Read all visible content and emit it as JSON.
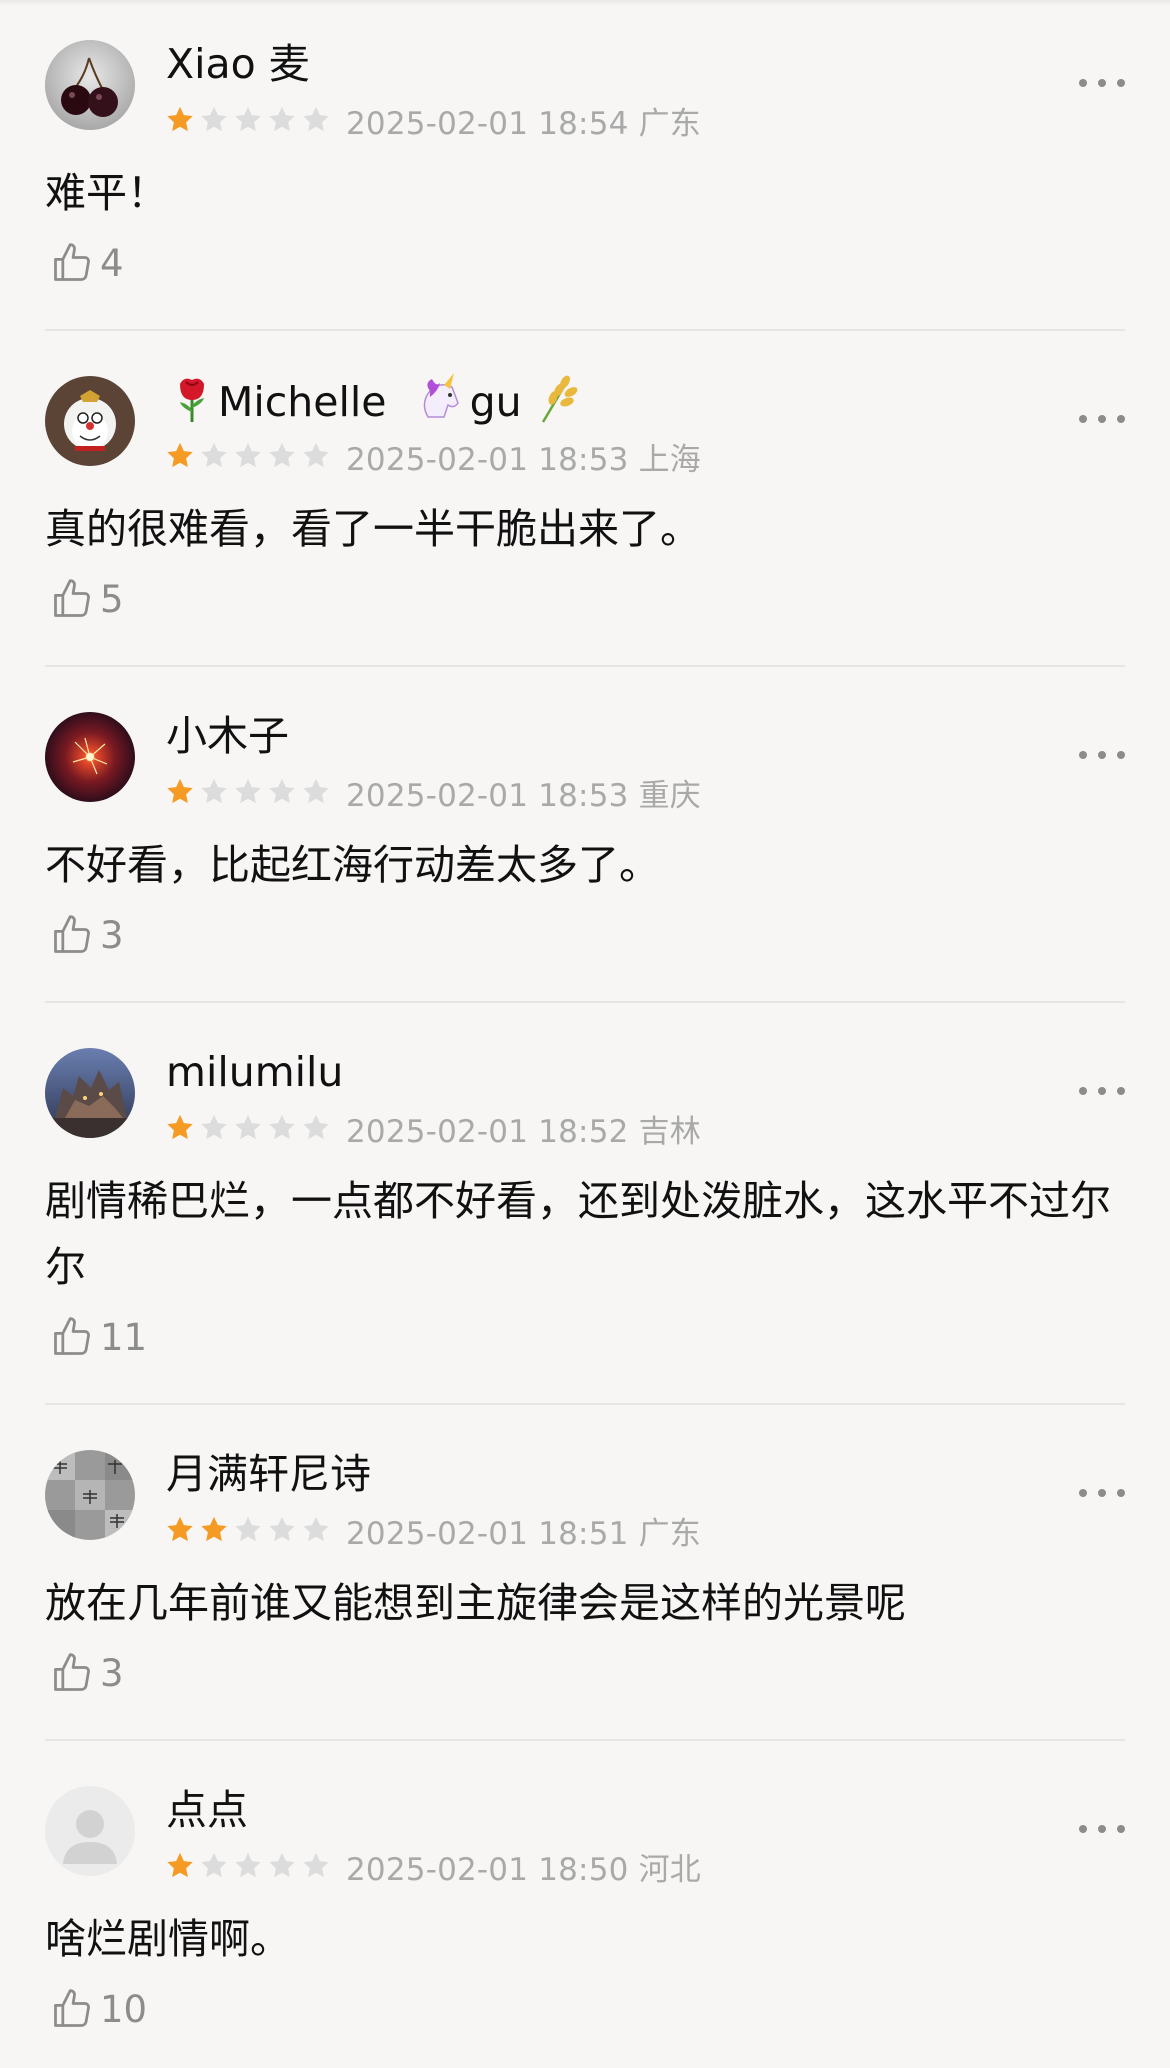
{
  "theme": {
    "star_on": "#f59a23",
    "star_off": "#dcdcdc",
    "meta_color": "#a9a9a9",
    "background": "#f7f6f5"
  },
  "reviews": [
    {
      "username": "Xiao 麦",
      "prefix_icon": "",
      "suffix_icons": [],
      "rating": 1,
      "datetime": "2025-02-01 18:54",
      "location": "广东",
      "content": "难平！",
      "likes": "4",
      "avatar": "cherry-avatar"
    },
    {
      "username": "Michelle",
      "prefix_icon": "rose-icon",
      "name_suffix": "gu",
      "suffix_icons": [
        "unicorn-icon",
        "rice-icon"
      ],
      "rating": 1,
      "datetime": "2025-02-01 18:53",
      "location": "上海",
      "content": "真的很难看，看了一半干脆出来了。",
      "likes": "5",
      "avatar": "doraemon-avatar"
    },
    {
      "username": "小木子",
      "prefix_icon": "",
      "suffix_icons": [],
      "rating": 1,
      "datetime": "2025-02-01 18:53",
      "location": "重庆",
      "content": "不好看，比起红海行动差太多了。",
      "likes": "3",
      "avatar": "sparkler-avatar"
    },
    {
      "username": "milumilu",
      "prefix_icon": "",
      "suffix_icons": [],
      "rating": 1,
      "datetime": "2025-02-01 18:52",
      "location": "吉林",
      "content": "剧情稀巴烂，一点都不好看，还到处泼脏水，这水平不过尔尔",
      "likes": "11",
      "avatar": "castle-avatar"
    },
    {
      "username": "月满轩尼诗",
      "prefix_icon": "",
      "suffix_icons": [],
      "rating": 2,
      "datetime": "2025-02-01 18:51",
      "location": "广东",
      "content": "放在几年前谁又能想到主旋律会是这样的光景呢",
      "likes": "3",
      "avatar": "dragonfly-avatar"
    },
    {
      "username": "点点",
      "prefix_icon": "",
      "suffix_icons": [],
      "rating": 1,
      "datetime": "2025-02-01 18:50",
      "location": "河北",
      "content": "啥烂剧情啊。",
      "likes": "10",
      "avatar": "default-avatar"
    }
  ]
}
